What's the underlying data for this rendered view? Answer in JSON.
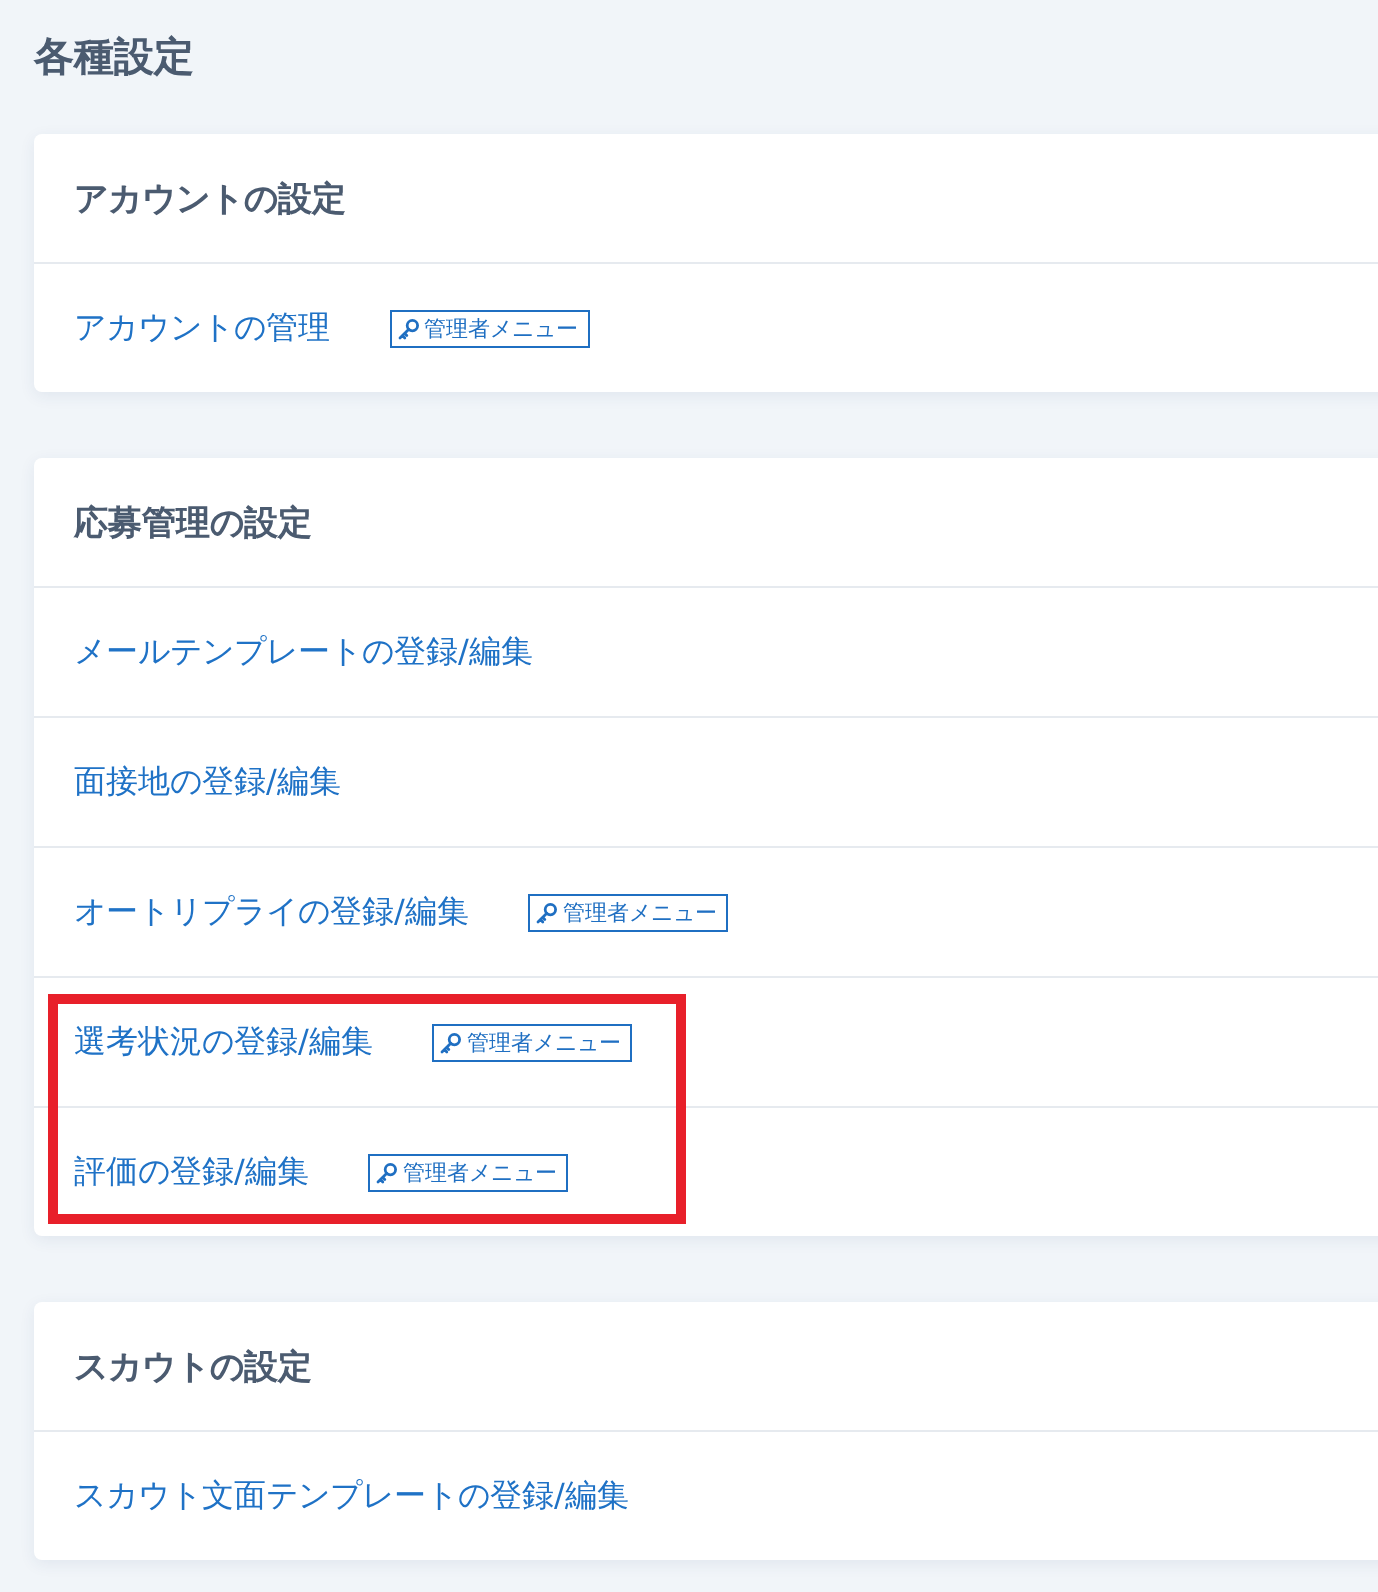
{
  "page_title": "各種設定",
  "sections": [
    {
      "title": "アカウントの設定",
      "items": [
        {
          "label": "アカウントの管理",
          "admin_badge": "管理者メニュー",
          "highlighted": false
        }
      ]
    },
    {
      "title": "応募管理の設定",
      "items": [
        {
          "label": "メールテンプレートの登録/編集",
          "highlighted": false
        },
        {
          "label": "面接地の登録/編集",
          "highlighted": false
        },
        {
          "label": "オートリプライの登録/編集",
          "admin_badge": "管理者メニュー",
          "highlighted": false
        },
        {
          "label": "選考状況の登録/編集",
          "admin_badge": "管理者メニュー",
          "highlighted": true
        },
        {
          "label": "評価の登録/編集",
          "admin_badge": "管理者メニュー",
          "highlighted": true
        }
      ]
    },
    {
      "title": "スカウトの設定",
      "items": [
        {
          "label": "スカウト文面テンプレートの登録/編集",
          "highlighted": false
        }
      ]
    }
  ]
}
